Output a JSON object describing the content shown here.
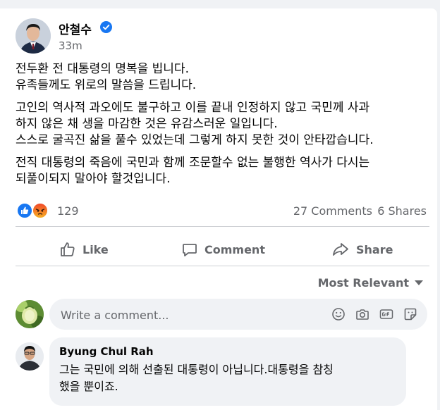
{
  "post": {
    "author": "안철수",
    "time": "33m",
    "paragraphs": [
      [
        "전두환 전 대통령의 명복을 빕니다.",
        "유족들께도 위로의 말씀을 드립니다."
      ],
      [
        "고인의 역사적 과오에도 불구하고 이를 끝내 인정하지 않고 국민께 사과",
        "하지 않은 채 생을 마감한 것은 유감스러운 일입니다.",
        "스스로 굴곡진 삶을 풀수 있었는데 그렇게 하지 못한 것이 안타깝습니다."
      ],
      [
        "전직 대통령의 죽음에 국민과 함께 조문할수 없는 불행한 역사가 다시는",
        "되풀이되지 말아야 할것입니다."
      ]
    ]
  },
  "stats": {
    "reaction_count": "129",
    "comments": "27 Comments",
    "shares": "6 Shares"
  },
  "actions": {
    "like": "Like",
    "comment": "Comment",
    "share": "Share"
  },
  "comments_section": {
    "sort_label": "Most Relevant",
    "input_placeholder": "Write a comment..."
  },
  "comment": {
    "author": "Byung Chul Rah",
    "lines": [
      "그는 국민에 의해 선출된 대통령이 아닙니다.대통령을 참칭",
      "했을 뿐이죠."
    ]
  },
  "colors": {
    "accent": "#1877f2",
    "secondary_text": "#65676b",
    "bubble_bg": "#f0f2f5"
  }
}
